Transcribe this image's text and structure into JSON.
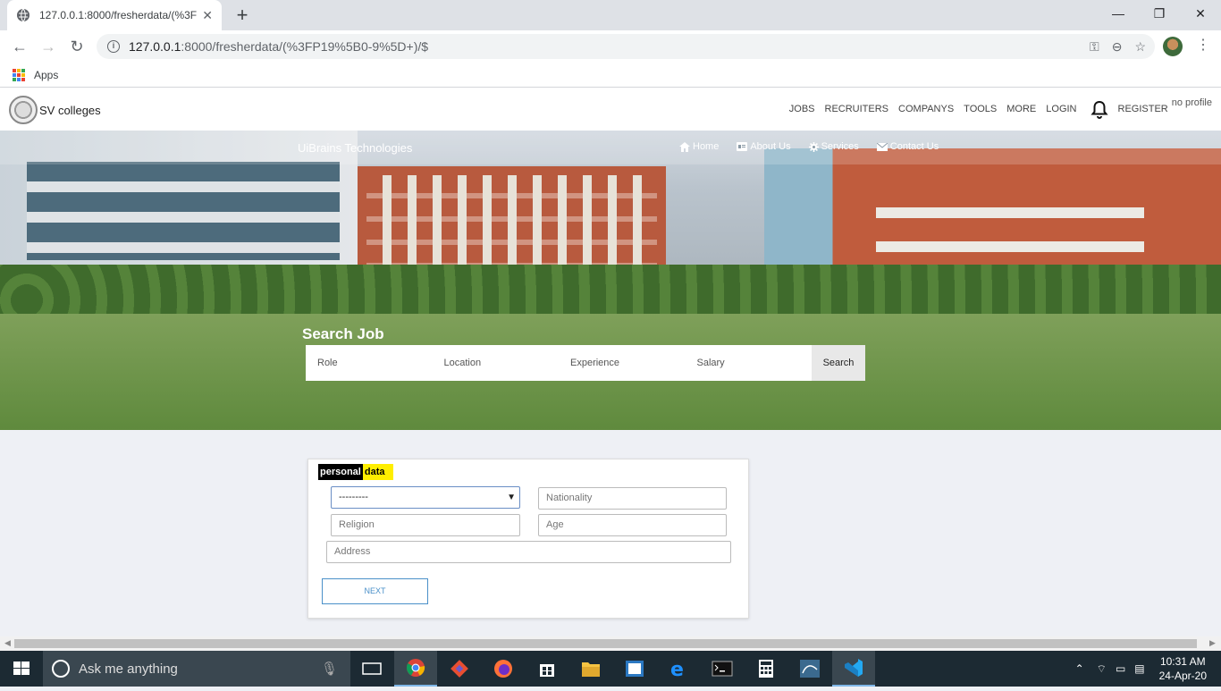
{
  "browser": {
    "tab_title": "127.0.0.1:8000/fresherdata/(%3FP",
    "tab_close": "✕",
    "new_tab": "+",
    "url_host": "127.0.0.1",
    "url_rest": ":8000/fresherdata/(%3FP19%5B0-9%5D+)/$",
    "bookmark_apps": "Apps",
    "window": {
      "minimize": "—",
      "maximize": "❐",
      "close": "✕"
    }
  },
  "site": {
    "brand": "SV colleges",
    "nav": [
      "JOBS",
      "RECRUITERS",
      "COMPANYS",
      "TOOLS",
      "MORE",
      "LOGIN"
    ],
    "register": "REGISTER",
    "profile_alt": "no profile"
  },
  "hero": {
    "brand": "UiBrains Technologies",
    "menu": [
      {
        "icon": "home-icon",
        "label": "Home"
      },
      {
        "icon": "card-icon",
        "label": "About Us"
      },
      {
        "icon": "gear-icon",
        "label": "Services"
      },
      {
        "icon": "envelope-icon",
        "label": "Contact Us"
      }
    ],
    "search_title": "Search Job",
    "search": {
      "role": "Role",
      "location": "Location",
      "experience": "Experience",
      "salary": "Salary",
      "button": "Search"
    }
  },
  "form": {
    "badge_a": "personal",
    "badge_b": "data",
    "select_value": "---------",
    "nationality_placeholder": "Nationality",
    "religion_placeholder": "Religion",
    "age_placeholder": "Age",
    "address_placeholder": "Address",
    "next": "NEXT"
  },
  "taskbar": {
    "search_placeholder": "Ask me anything",
    "time": "10:31 AM",
    "date": "24-Apr-20"
  }
}
